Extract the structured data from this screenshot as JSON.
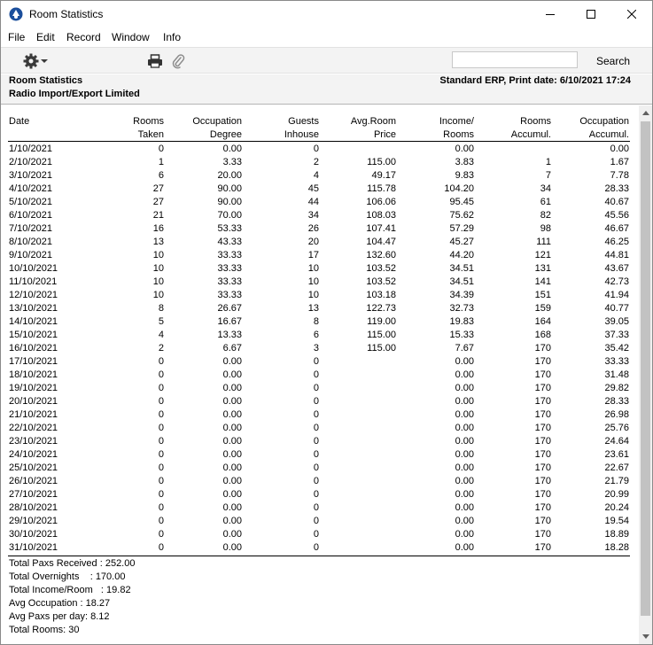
{
  "window": {
    "title": "Room Statistics"
  },
  "menu": [
    "File",
    "Edit",
    "Record",
    "Window",
    "Info"
  ],
  "toolbar": {
    "search_value": "",
    "search_label": "Search"
  },
  "report": {
    "title": "Room Statistics",
    "company": "Radio Import/Export Limited",
    "header_right": "Standard ERP, Print date: 6/10/2021 17:24"
  },
  "columns": [
    {
      "line1": "",
      "line2": "Date"
    },
    {
      "line1": "Rooms",
      "line2": "Taken"
    },
    {
      "line1": "Occupation",
      "line2": "Degree"
    },
    {
      "line1": "Guests",
      "line2": "Inhouse"
    },
    {
      "line1": "Avg.Room",
      "line2": "Price"
    },
    {
      "line1": "Income/",
      "line2": "Rooms"
    },
    {
      "line1": "Rooms",
      "line2": "Accumul."
    },
    {
      "line1": "Occupation",
      "line2": "Accumul."
    }
  ],
  "rows": [
    [
      "1/10/2021",
      "0",
      "0.00",
      "0",
      "",
      "0.00",
      "",
      "0.00"
    ],
    [
      "2/10/2021",
      "1",
      "3.33",
      "2",
      "115.00",
      "3.83",
      "1",
      "1.67"
    ],
    [
      "3/10/2021",
      "6",
      "20.00",
      "4",
      "49.17",
      "9.83",
      "7",
      "7.78"
    ],
    [
      "4/10/2021",
      "27",
      "90.00",
      "45",
      "115.78",
      "104.20",
      "34",
      "28.33"
    ],
    [
      "5/10/2021",
      "27",
      "90.00",
      "44",
      "106.06",
      "95.45",
      "61",
      "40.67"
    ],
    [
      "6/10/2021",
      "21",
      "70.00",
      "34",
      "108.03",
      "75.62",
      "82",
      "45.56"
    ],
    [
      "7/10/2021",
      "16",
      "53.33",
      "26",
      "107.41",
      "57.29",
      "98",
      "46.67"
    ],
    [
      "8/10/2021",
      "13",
      "43.33",
      "20",
      "104.47",
      "45.27",
      "111",
      "46.25"
    ],
    [
      "9/10/2021",
      "10",
      "33.33",
      "17",
      "132.60",
      "44.20",
      "121",
      "44.81"
    ],
    [
      "10/10/2021",
      "10",
      "33.33",
      "10",
      "103.52",
      "34.51",
      "131",
      "43.67"
    ],
    [
      "11/10/2021",
      "10",
      "33.33",
      "10",
      "103.52",
      "34.51",
      "141",
      "42.73"
    ],
    [
      "12/10/2021",
      "10",
      "33.33",
      "10",
      "103.18",
      "34.39",
      "151",
      "41.94"
    ],
    [
      "13/10/2021",
      "8",
      "26.67",
      "13",
      "122.73",
      "32.73",
      "159",
      "40.77"
    ],
    [
      "14/10/2021",
      "5",
      "16.67",
      "8",
      "119.00",
      "19.83",
      "164",
      "39.05"
    ],
    [
      "15/10/2021",
      "4",
      "13.33",
      "6",
      "115.00",
      "15.33",
      "168",
      "37.33"
    ],
    [
      "16/10/2021",
      "2",
      "6.67",
      "3",
      "115.00",
      "7.67",
      "170",
      "35.42"
    ],
    [
      "17/10/2021",
      "0",
      "0.00",
      "0",
      "",
      "0.00",
      "170",
      "33.33"
    ],
    [
      "18/10/2021",
      "0",
      "0.00",
      "0",
      "",
      "0.00",
      "170",
      "31.48"
    ],
    [
      "19/10/2021",
      "0",
      "0.00",
      "0",
      "",
      "0.00",
      "170",
      "29.82"
    ],
    [
      "20/10/2021",
      "0",
      "0.00",
      "0",
      "",
      "0.00",
      "170",
      "28.33"
    ],
    [
      "21/10/2021",
      "0",
      "0.00",
      "0",
      "",
      "0.00",
      "170",
      "26.98"
    ],
    [
      "22/10/2021",
      "0",
      "0.00",
      "0",
      "",
      "0.00",
      "170",
      "25.76"
    ],
    [
      "23/10/2021",
      "0",
      "0.00",
      "0",
      "",
      "0.00",
      "170",
      "24.64"
    ],
    [
      "24/10/2021",
      "0",
      "0.00",
      "0",
      "",
      "0.00",
      "170",
      "23.61"
    ],
    [
      "25/10/2021",
      "0",
      "0.00",
      "0",
      "",
      "0.00",
      "170",
      "22.67"
    ],
    [
      "26/10/2021",
      "0",
      "0.00",
      "0",
      "",
      "0.00",
      "170",
      "21.79"
    ],
    [
      "27/10/2021",
      "0",
      "0.00",
      "0",
      "",
      "0.00",
      "170",
      "20.99"
    ],
    [
      "28/10/2021",
      "0",
      "0.00",
      "0",
      "",
      "0.00",
      "170",
      "20.24"
    ],
    [
      "29/10/2021",
      "0",
      "0.00",
      "0",
      "",
      "0.00",
      "170",
      "19.54"
    ],
    [
      "30/10/2021",
      "0",
      "0.00",
      "0",
      "",
      "0.00",
      "170",
      "18.89"
    ],
    [
      "31/10/2021",
      "0",
      "0.00",
      "0",
      "",
      "0.00",
      "170",
      "18.28"
    ]
  ],
  "totals": [
    "Total Paxs Received : 252.00",
    "Total Overnights    : 170.00",
    "Total Income/Room   : 19.82",
    "Avg Occupation : 18.27",
    "Avg Paxs per day: 8.12",
    "Total Rooms: 30"
  ]
}
